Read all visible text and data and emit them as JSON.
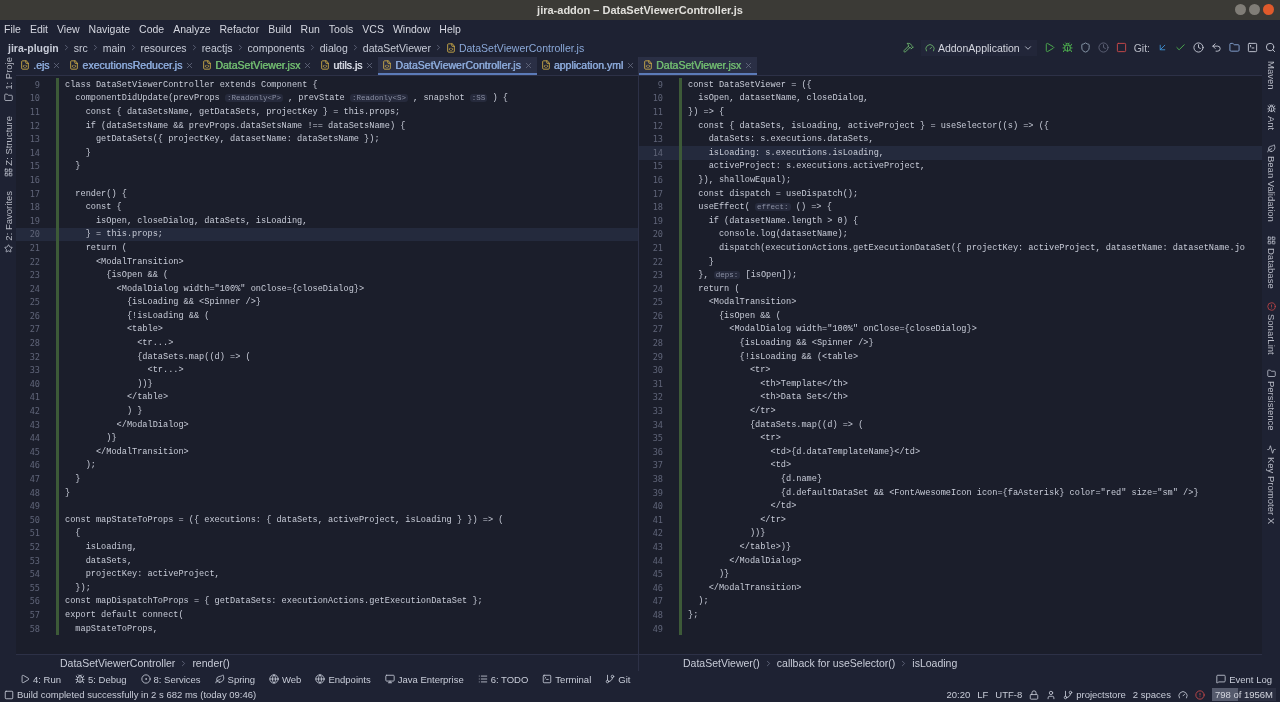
{
  "window": {
    "title": "jira-addon – DataSetViewerController.js"
  },
  "menu": [
    "File",
    "Edit",
    "View",
    "Navigate",
    "Code",
    "Analyze",
    "Refactor",
    "Build",
    "Run",
    "Tools",
    "VCS",
    "Window",
    "Help"
  ],
  "navigation": [
    "jira-plugin",
    "src",
    "main",
    "resources",
    "reactjs",
    "components",
    "dialog",
    "dataSetViewer",
    "DataSetViewerController.js"
  ],
  "run_configuration": "AddonApplication",
  "git_label": "Git:",
  "left_tool_windows": [
    "1: Proje",
    "Z: Structure",
    "2: Favorites"
  ],
  "right_tool_windows": [
    "Maven",
    "Ant",
    "Bean Validation",
    "Database",
    "SonarLint",
    "Persistence",
    "Key Promoter X"
  ],
  "editors": [
    {
      "tabs": [
        {
          "label": ".ejs",
          "selected": false,
          "color": "#8aa8d8"
        },
        {
          "label": "executionsReducer.js",
          "selected": false,
          "color": "#8aa8d8"
        },
        {
          "label": "DataSetViewer.jsx",
          "selected": false,
          "color": "#6fb86f"
        },
        {
          "label": "utils.js",
          "selected": false,
          "color": "#d6d9e3"
        },
        {
          "label": "DataSetViewerController.js",
          "selected": true,
          "color": "#8aa8d8"
        },
        {
          "label": "application.yml",
          "selected": false,
          "color": "#8aa8d8"
        }
      ],
      "lines": [
        {
          "number": "9",
          "current": false,
          "code": "class DataSetViewerController extends Component {"
        },
        {
          "number": "10",
          "current": false,
          "code": [
            {
              "kind": "code",
              "text": "  componentDidUpdate(prevProps "
            },
            {
              "kind": "hint",
              "text": ":Readonly<P>"
            },
            {
              "kind": "code",
              "text": " , prevState "
            },
            {
              "kind": "hint",
              "text": ":Readonly<S>"
            },
            {
              "kind": "code",
              "text": " , snapshot "
            },
            {
              "kind": "hint",
              "text": ":SS"
            },
            {
              "kind": "code",
              "text": " ) {"
            }
          ]
        },
        {
          "number": "11",
          "current": false,
          "code": "    const { dataSetsName, getDataSets, projectKey } = this.props;"
        },
        {
          "number": "12",
          "current": false,
          "code": "    if (dataSetsName && prevProps.dataSetsName !== dataSetsName) {"
        },
        {
          "number": "13",
          "current": false,
          "code": "      getDataSets({ projectKey, datasetName: dataSetsName });"
        },
        {
          "number": "14",
          "current": false,
          "code": "    }"
        },
        {
          "number": "15",
          "current": false,
          "code": "  }"
        },
        {
          "number": "16",
          "current": false
        },
        {
          "number": "17",
          "current": false,
          "code": "  render() {"
        },
        {
          "number": "18",
          "current": false,
          "code": "    const {"
        },
        {
          "number": "19",
          "current": false,
          "code": "      isOpen, closeDialog, dataSets, isLoading,"
        },
        {
          "number": "20",
          "current": true,
          "code": "    } = this.props;"
        },
        {
          "number": "21",
          "current": false,
          "code": "    return ("
        },
        {
          "number": "22",
          "current": false,
          "code": "      <ModalTransition>"
        },
        {
          "number": "23",
          "current": false,
          "code": "        {isOpen && ("
        },
        {
          "number": "24",
          "current": false,
          "code": "          <ModalDialog width=\"100%\" onClose={closeDialog}>"
        },
        {
          "number": "25",
          "current": false,
          "code": "            {isLoading && <Spinner />}"
        },
        {
          "number": "26",
          "current": false,
          "code": "            {!isLoading && ("
        },
        {
          "number": "27",
          "current": false,
          "code": "            <table>"
        },
        {
          "number": "28",
          "current": false,
          "code": "              <tr...>"
        },
        {
          "number": "32",
          "current": false,
          "code": "              {dataSets.map((d) => ("
        },
        {
          "number": "33",
          "current": false,
          "code": "                <tr...>"
        },
        {
          "number": "40",
          "current": false,
          "code": "              ))}"
        },
        {
          "number": "41",
          "current": false,
          "code": "            </table>"
        },
        {
          "number": "42",
          "current": false,
          "code": "            ) }"
        },
        {
          "number": "43",
          "current": false,
          "code": "          </ModalDialog>"
        },
        {
          "number": "44",
          "current": false,
          "code": "        )}"
        },
        {
          "number": "45",
          "current": false,
          "code": "      </ModalTransition>"
        },
        {
          "number": "46",
          "current": false,
          "code": "    );"
        },
        {
          "number": "47",
          "current": false,
          "code": "  }"
        },
        {
          "number": "48",
          "current": false,
          "code": "}"
        },
        {
          "number": "49",
          "current": false
        },
        {
          "number": "50",
          "current": false,
          "code": "const mapStateToProps = ({ executions: { dataSets, activeProject, isLoading } }) => ("
        },
        {
          "number": "51",
          "current": false,
          "code": "  {"
        },
        {
          "number": "52",
          "current": false,
          "code": "    isLoading,"
        },
        {
          "number": "53",
          "current": false,
          "code": "    dataSets,"
        },
        {
          "number": "54",
          "current": false,
          "code": "    projectKey: activeProject,"
        },
        {
          "number": "55",
          "current": false,
          "code": "  });"
        },
        {
          "number": "56",
          "current": false,
          "code": "const mapDispatchToProps = { getDataSets: executionActions.getExecutionDataSet };"
        },
        {
          "number": "57",
          "current": false,
          "code": "export default connect("
        },
        {
          "number": "58",
          "current": false,
          "code": "  mapStateToProps,"
        }
      ],
      "breadcrumbs": [
        "DataSetViewerController",
        "render()"
      ]
    },
    {
      "tabs": [
        {
          "label": "DataSetViewer.jsx",
          "selected": true,
          "color": "#6fb86f"
        }
      ],
      "lines": [
        {
          "number": "9",
          "current": false,
          "code": "const DataSetViewer = ({"
        },
        {
          "number": "10",
          "current": false,
          "code": "  isOpen, datasetName, closeDialog,"
        },
        {
          "number": "11",
          "current": false,
          "code": "}) => {"
        },
        {
          "number": "12",
          "current": false,
          "code": "  const { dataSets, isLoading, activeProject } = useSelector((s) => ({"
        },
        {
          "number": "13",
          "current": false,
          "code": "    dataSets: s.executions.dataSets,"
        },
        {
          "number": "14",
          "current": true,
          "code": "    isLoading: s.executions.isLoading,"
        },
        {
          "number": "15",
          "current": false,
          "code": "    activeProject: s.executions.activeProject,"
        },
        {
          "number": "16",
          "current": false,
          "code": "  }), shallowEqual);"
        },
        {
          "number": "17",
          "current": false,
          "code": "  const dispatch = useDispatch();"
        },
        {
          "number": "18",
          "current": false,
          "code": [
            {
              "kind": "code",
              "text": "  useEffect( "
            },
            {
              "kind": "hint",
              "text": "effect:"
            },
            {
              "kind": "code",
              "text": " () => {"
            }
          ]
        },
        {
          "number": "19",
          "current": false,
          "code": "    if (datasetName.length > 0) {"
        },
        {
          "number": "20",
          "current": false,
          "code": "      console.log(datasetName);"
        },
        {
          "number": "21",
          "current": false,
          "code": "      dispatch(executionActions.getExecutionDataSet({ projectKey: activeProject, datasetName: datasetName.jo"
        },
        {
          "number": "22",
          "current": false,
          "code": "    }"
        },
        {
          "number": "23",
          "current": false,
          "code": [
            {
              "kind": "code",
              "text": "  }, "
            },
            {
              "kind": "hint",
              "text": "deps:"
            },
            {
              "kind": "code",
              "text": " [isOpen]);"
            }
          ]
        },
        {
          "number": "24",
          "current": false,
          "code": "  return ("
        },
        {
          "number": "25",
          "current": false,
          "code": "    <ModalTransition>"
        },
        {
          "number": "26",
          "current": false,
          "code": "      {isOpen && ("
        },
        {
          "number": "27",
          "current": false,
          "code": "        <ModalDialog width=\"100%\" onClose={closeDialog}>"
        },
        {
          "number": "28",
          "current": false,
          "code": "          {isLoading && <Spinner />}"
        },
        {
          "number": "29",
          "current": false,
          "code": "          {!isLoading && (<table>"
        },
        {
          "number": "30",
          "current": false,
          "code": "            <tr>"
        },
        {
          "number": "31",
          "current": false,
          "code": "              <th>Template</th>"
        },
        {
          "number": "32",
          "current": false,
          "code": "              <th>Data Set</th>"
        },
        {
          "number": "33",
          "current": false,
          "code": "            </tr>"
        },
        {
          "number": "34",
          "current": false,
          "code": "            {dataSets.map((d) => ("
        },
        {
          "number": "35",
          "current": false,
          "code": "              <tr>"
        },
        {
          "number": "36",
          "current": false,
          "code": "                <td>{d.dataTemplateName}</td>"
        },
        {
          "number": "37",
          "current": false,
          "code": "                <td>"
        },
        {
          "number": "38",
          "current": false,
          "code": "                  {d.name}"
        },
        {
          "number": "39",
          "current": false,
          "code": "                  {d.defaultDataSet && <FontAwesomeIcon icon={faAsterisk} color=\"red\" size=\"sm\" />}"
        },
        {
          "number": "40",
          "current": false,
          "code": "                </td>"
        },
        {
          "number": "41",
          "current": false,
          "code": "              </tr>"
        },
        {
          "number": "42",
          "current": false,
          "code": "            ))}"
        },
        {
          "number": "43",
          "current": false,
          "code": "          </table>)}"
        },
        {
          "number": "44",
          "current": false,
          "code": "        </ModalDialog>"
        },
        {
          "number": "45",
          "current": false,
          "code": "      )}"
        },
        {
          "number": "46",
          "current": false,
          "code": "    </ModalTransition>"
        },
        {
          "number": "47",
          "current": false,
          "code": "  );"
        },
        {
          "number": "48",
          "current": false,
          "code": "};"
        },
        {
          "number": "49",
          "current": false
        }
      ],
      "breadcrumbs": [
        "DataSetViewer()",
        "callback for useSelector()",
        "isLoading"
      ]
    }
  ],
  "tool_windows": [
    "4: Run",
    "5: Debug",
    "8: Services",
    "Spring",
    "Web",
    "Endpoints",
    "Java Enterprise",
    "6: TODO",
    "Terminal",
    "Git"
  ],
  "event_log": "Event Log",
  "status": {
    "message": "Build completed successfully in 2 s 682 ms (today 09:46)",
    "position": "20:20",
    "line_separator": "LF",
    "encoding": "UTF-8",
    "branch": "projectstore",
    "indent": "2 spaces",
    "memory": {
      "text": "798 of 1956M",
      "level": 0.41
    }
  }
}
